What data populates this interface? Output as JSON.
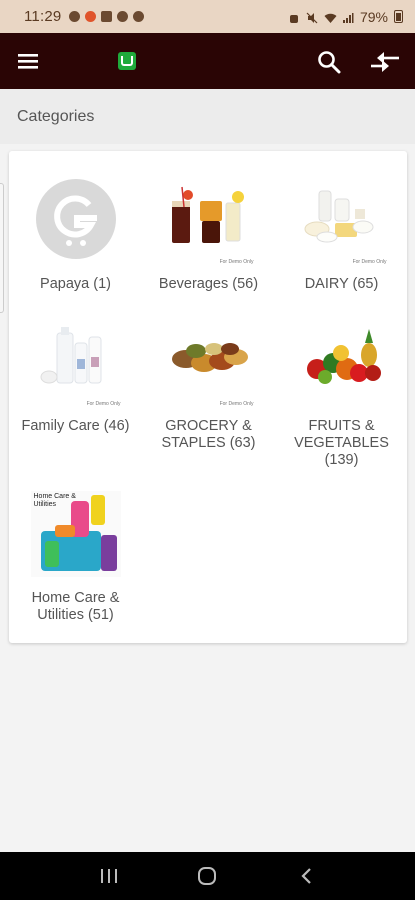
{
  "status_bar": {
    "time": "11:29",
    "battery": "79%"
  },
  "app_bar": {
    "menu_icon": "hamburger-menu-icon",
    "logo_icon": "app-logo-icon",
    "search_icon": "search-icon",
    "switch_icon": "swap-arrows-icon",
    "background": "#2a0505"
  },
  "section": {
    "title": "Categories"
  },
  "categories": [
    {
      "label": "Papaya (1)",
      "image": "placeholder-logo"
    },
    {
      "label": "Beverages (56)",
      "image": "beverages"
    },
    {
      "label": "DAIRY (65)",
      "image": "dairy"
    },
    {
      "label": "Family Care (46)",
      "image": "family-care"
    },
    {
      "label": "GROCERY & STAPLES (63)",
      "image": "grocery-staples"
    },
    {
      "label": "FRUITS & VEGETABLES (139)",
      "image": "fruits-vegetables"
    },
    {
      "label": "Home Care & Utilities (51)",
      "image": "home-care",
      "image_text": "Home Care & Utilities"
    }
  ],
  "demo_tag": "For Demo Only",
  "nav_bar": {
    "recents_icon": "recents-icon",
    "home_icon": "home-icon",
    "back_icon": "back-icon"
  }
}
